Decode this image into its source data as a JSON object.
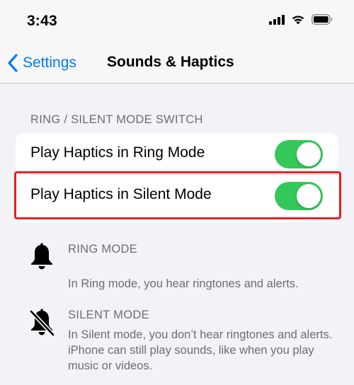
{
  "status_bar": {
    "time": "3:43",
    "icons": [
      "cellular-signal-icon",
      "wifi-icon",
      "battery-icon"
    ]
  },
  "nav": {
    "back_label": "Settings",
    "title": "Sounds & Haptics"
  },
  "section": {
    "header": "RING / SILENT MODE SWITCH",
    "rows": [
      {
        "label": "Play Haptics in Ring Mode",
        "toggle_on": true
      },
      {
        "label": "Play Haptics in Silent Mode",
        "toggle_on": true
      }
    ]
  },
  "info": [
    {
      "icon": "bell-icon",
      "title": "RING MODE",
      "description": "In Ring mode, you hear ringtones and alerts."
    },
    {
      "icon": "bell-slash-icon",
      "title": "SILENT MODE",
      "description": "In Silent mode, you don’t hear ringtones and alerts. iPhone can still play sounds, like when you play music or videos."
    }
  ],
  "colors": {
    "accent": "#007aff",
    "toggle_on": "#34c759",
    "highlight": "#e52121",
    "background": "#f2f2f7",
    "secondary_text": "#6d6d72"
  }
}
